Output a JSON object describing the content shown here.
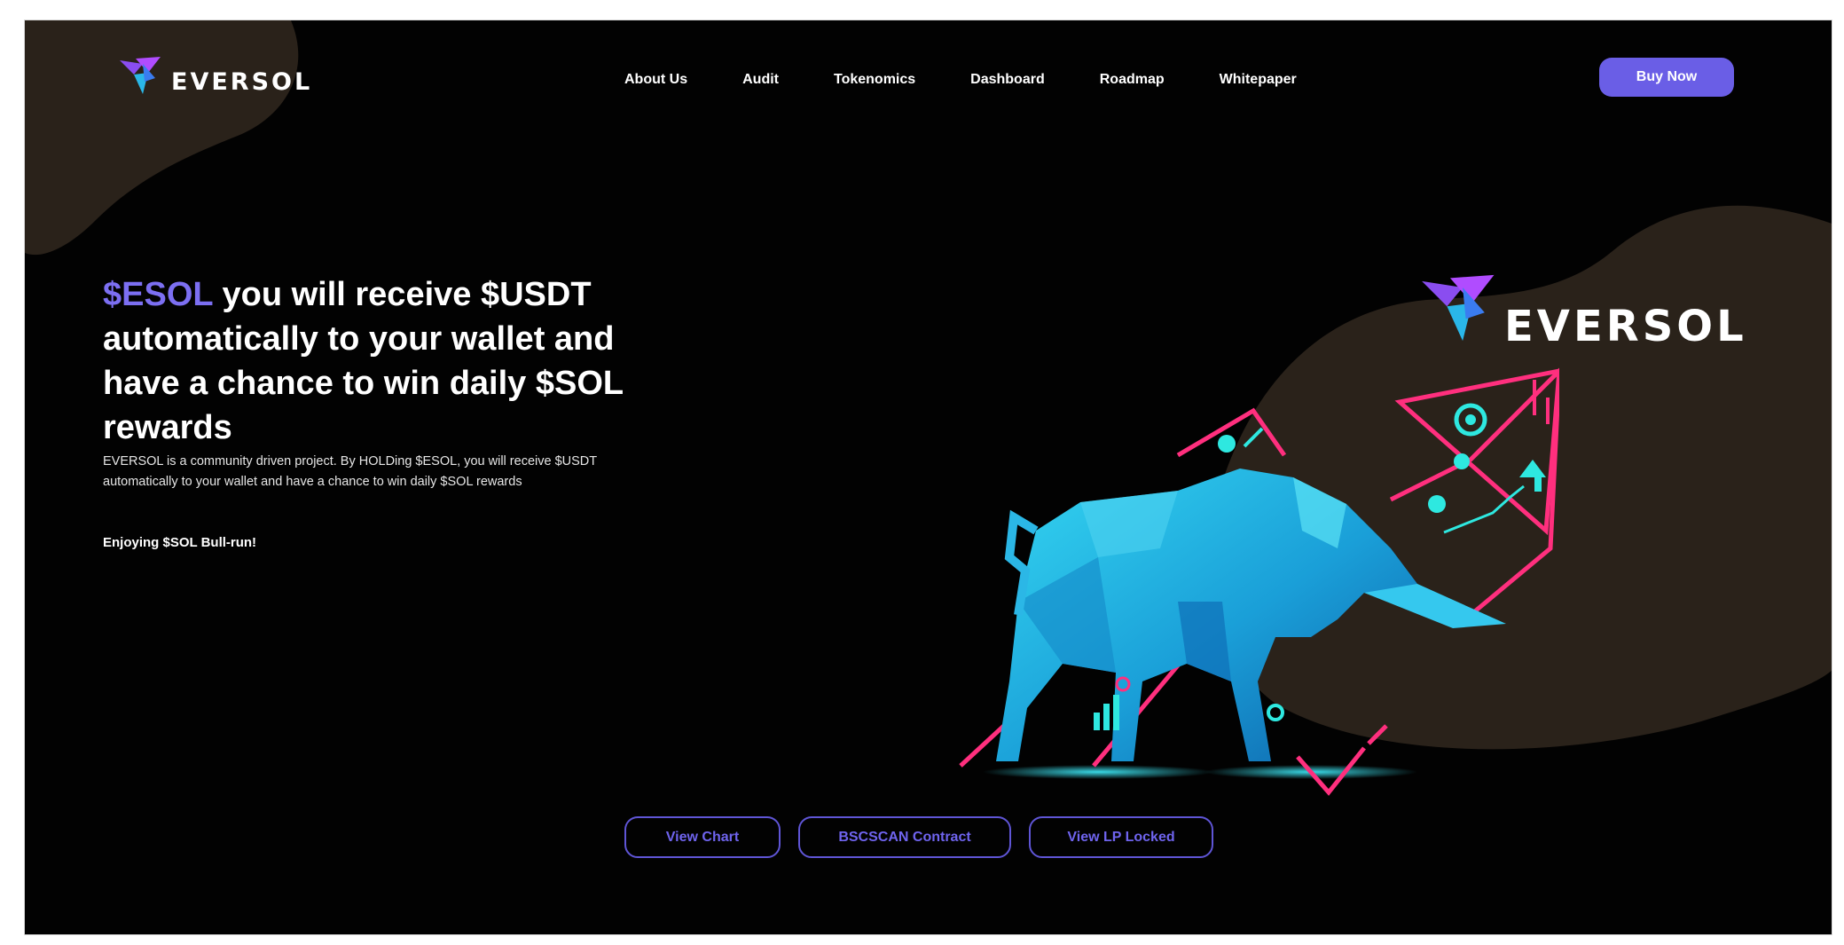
{
  "brand": {
    "name": "EVERSOL",
    "accent_color": "#6a5ee6",
    "logo_icon": "eversol-logo-icon"
  },
  "nav": {
    "links": [
      {
        "label": "About Us"
      },
      {
        "label": "Audit"
      },
      {
        "label": "Tokenomics"
      },
      {
        "label": "Dashboard"
      },
      {
        "label": "Roadmap"
      },
      {
        "label": "Whitepaper"
      }
    ],
    "buy_label": "Buy Now"
  },
  "hero": {
    "title_accent": "$ESOL",
    "title_rest": " you will receive $USDT automatically to your wallet and have a chance to win daily $SOL rewards",
    "description": "EVERSOL is a community driven project. By HOLDing $ESOL, you will receive $USDT automatically to your wallet and have a chance to win daily $SOL rewards",
    "tagline": "Enjoying $SOL Bull-run!"
  },
  "illustration": {
    "subject": "bull-illustration",
    "colors": {
      "bull": "#1fb8e0",
      "arrow": "#ff2f7e",
      "icons": "#2ee8e0",
      "blob": "#2a221a"
    }
  },
  "cta": {
    "buttons": [
      {
        "label": "View Chart"
      },
      {
        "label": "BSCSCAN Contract"
      },
      {
        "label": "View LP Locked"
      }
    ],
    "border_color": "#5f55d6"
  }
}
